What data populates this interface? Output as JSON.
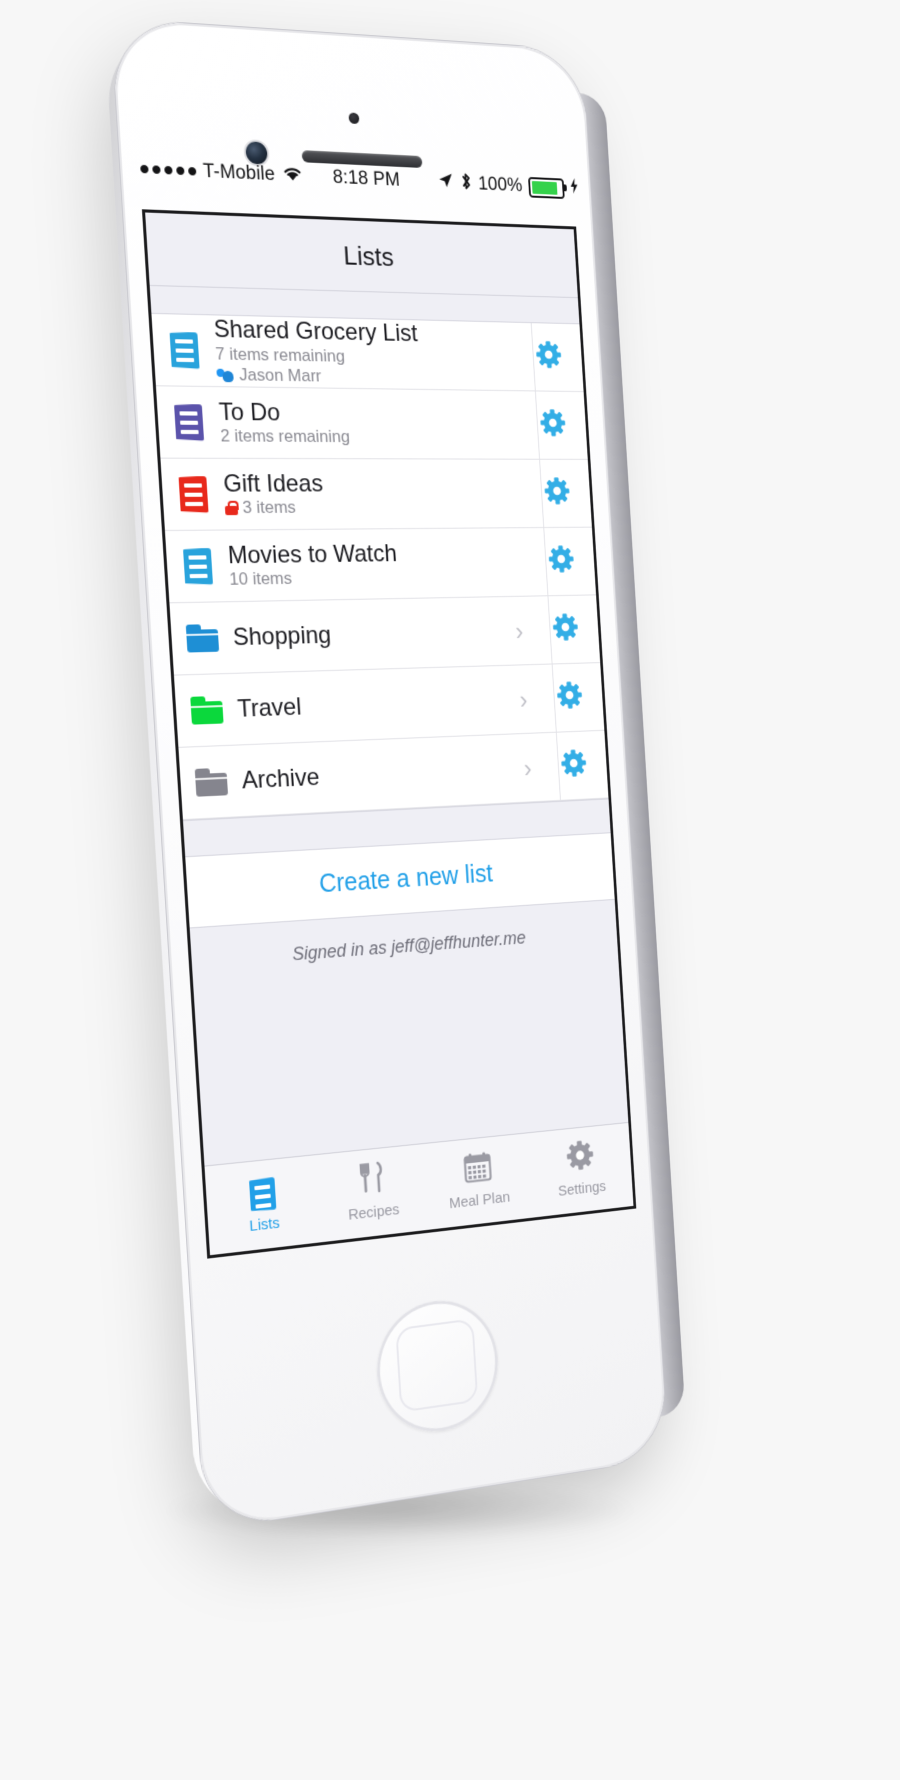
{
  "status_bar": {
    "signal_dots": 5,
    "carrier": "T-Mobile",
    "wifi_icon": "wifi-icon",
    "time": "8:18 PM",
    "location_icon": "location-arrow-icon",
    "bluetooth_icon": "bluetooth-icon",
    "battery_percent": "100%",
    "battery_color": "#35d24b"
  },
  "nav": {
    "title": "Lists",
    "more_icon": "more-horizontal-icon"
  },
  "lists": [
    {
      "name": "Shared Grocery List",
      "subtitle": "7 items remaining",
      "shared_with": "Jason Marr",
      "share_icon": "people-icon",
      "icon": "list-doc-icon",
      "color": "#29a3dc",
      "locked": false,
      "type": "list",
      "gear_icon": "gear-icon"
    },
    {
      "name": "To Do",
      "subtitle": "2 items remaining",
      "shared_with": "",
      "icon": "list-doc-icon",
      "color": "#5b53ab",
      "locked": false,
      "type": "list",
      "gear_icon": "gear-icon"
    },
    {
      "name": "Gift Ideas",
      "subtitle": "3 items",
      "shared_with": "",
      "icon": "list-doc-icon",
      "color": "#e8291c",
      "locked": true,
      "lock_icon": "lock-icon",
      "type": "list",
      "gear_icon": "gear-icon"
    },
    {
      "name": "Movies to Watch",
      "subtitle": "10 items",
      "shared_with": "",
      "icon": "list-doc-icon",
      "color": "#29a3dc",
      "locked": false,
      "type": "list",
      "gear_icon": "gear-icon"
    },
    {
      "name": "Shopping",
      "subtitle": "",
      "icon": "folder-icon",
      "color": "#1e8fd5",
      "locked": false,
      "type": "folder",
      "chevron": "›",
      "gear_icon": "gear-icon"
    },
    {
      "name": "Travel",
      "subtitle": "",
      "icon": "folder-icon",
      "color": "#0bd83c",
      "locked": false,
      "type": "folder",
      "chevron": "›",
      "gear_icon": "gear-icon"
    },
    {
      "name": "Archive",
      "subtitle": "",
      "icon": "folder-icon",
      "color": "#85858e",
      "locked": false,
      "type": "folder",
      "chevron": "›",
      "gear_icon": "gear-icon"
    }
  ],
  "footer": {
    "create_label": "Create a new list",
    "create_color": "#22a0e8",
    "signed_in_text": "Signed in as jeff@jeffhunter.me"
  },
  "tabs": [
    {
      "label": "Lists",
      "icon": "list-doc-icon",
      "active": true
    },
    {
      "label": "Recipes",
      "icon": "fork-knife-icon",
      "active": false
    },
    {
      "label": "Meal Plan",
      "icon": "calendar-icon",
      "active": false
    },
    {
      "label": "Settings",
      "icon": "gear-icon",
      "active": false
    }
  ]
}
